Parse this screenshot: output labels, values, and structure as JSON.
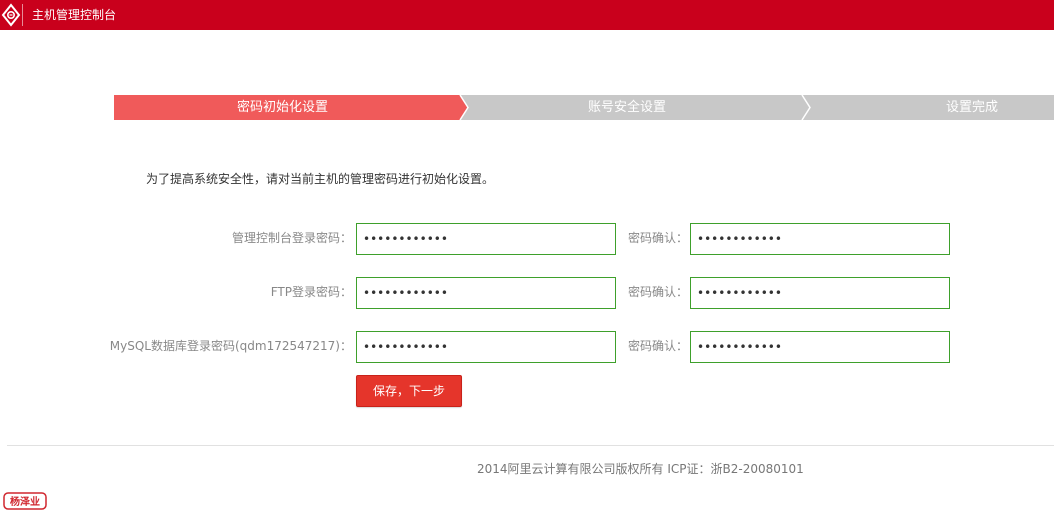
{
  "header": {
    "title": "主机管理控制台",
    "logo_icon": "aliyun-logo-icon"
  },
  "steps": [
    {
      "label": "密码初始化设置",
      "active": true
    },
    {
      "label": "账号安全设置",
      "active": false
    },
    {
      "label": "设置完成",
      "active": false
    }
  ],
  "colors": {
    "header_bg": "#c9001c",
    "step_active": "#f05a5a",
    "step_inactive": "#c8c8c8",
    "field_border": "#3ea02b",
    "button_bg": "#e5352b"
  },
  "intro": "为了提高系统安全性，请对当前主机的管理密码进行初始化设置。",
  "form": {
    "rows": [
      {
        "label": "管理控制台登录密码：",
        "password_value": "************",
        "confirm_label": "密码确认：",
        "confirm_value": "************"
      },
      {
        "label": "FTP登录密码：",
        "password_value": "************",
        "confirm_label": "密码确认：",
        "confirm_value": "************"
      },
      {
        "label": "MySQL数据库登录密码(qdm172547217)：",
        "password_value": "************",
        "confirm_label": "密码确认：",
        "confirm_value": "************"
      }
    ],
    "submit_label": "保存，下一步"
  },
  "footer": {
    "copyright": "2014阿里云计算有限公司版权所有 ICP证：浙B2-20080101"
  },
  "watermark": {
    "icon": "seal-stamp-icon",
    "text": "杨泽业"
  }
}
